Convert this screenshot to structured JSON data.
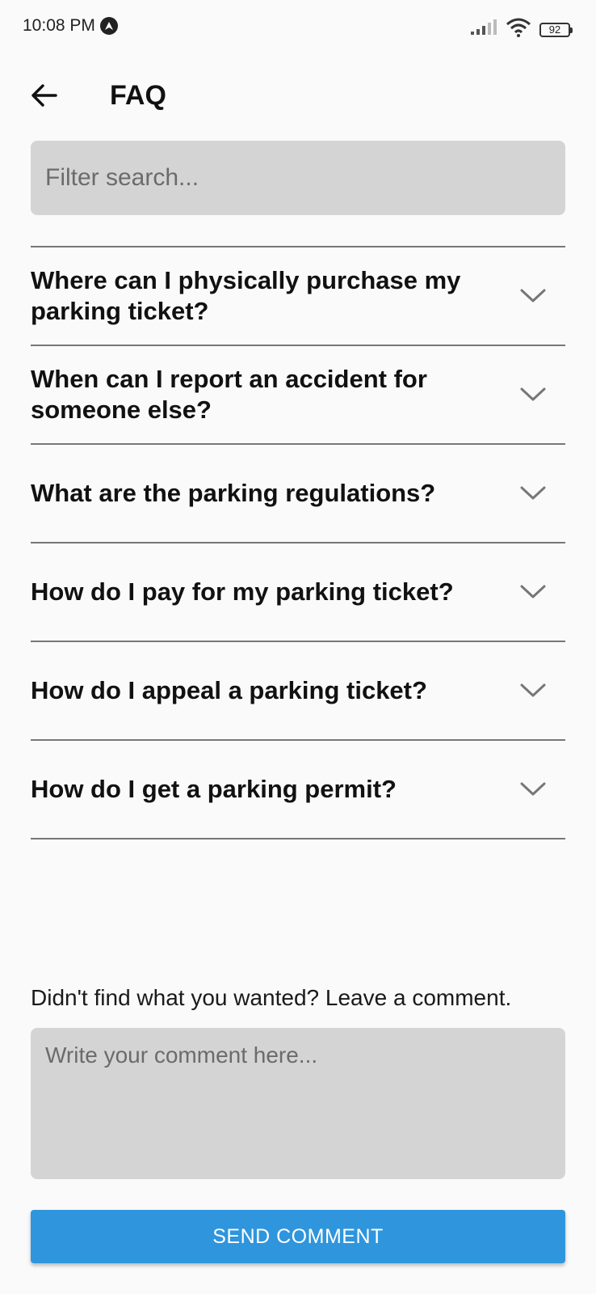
{
  "status_bar": {
    "time": "10:08 PM",
    "battery": "92"
  },
  "header": {
    "title": "FAQ"
  },
  "search": {
    "placeholder": "Filter search..."
  },
  "faq": {
    "items": [
      {
        "question": "Where can I physically purchase my parking ticket?"
      },
      {
        "question": "When can I report an accident for someone else?"
      },
      {
        "question": "What are the parking regulations?"
      },
      {
        "question": "How do I pay for my parking ticket?"
      },
      {
        "question": "How do I appeal a parking ticket?"
      },
      {
        "question": "How do I get a parking permit?"
      }
    ]
  },
  "comment": {
    "prompt": "Didn't find what you wanted? Leave a comment.",
    "placeholder": "Write your comment here...",
    "send_label": "SEND COMMENT"
  },
  "colors": {
    "accent": "#2f95dc",
    "input_background": "#d4d4d4",
    "page_background": "#fafafa"
  }
}
